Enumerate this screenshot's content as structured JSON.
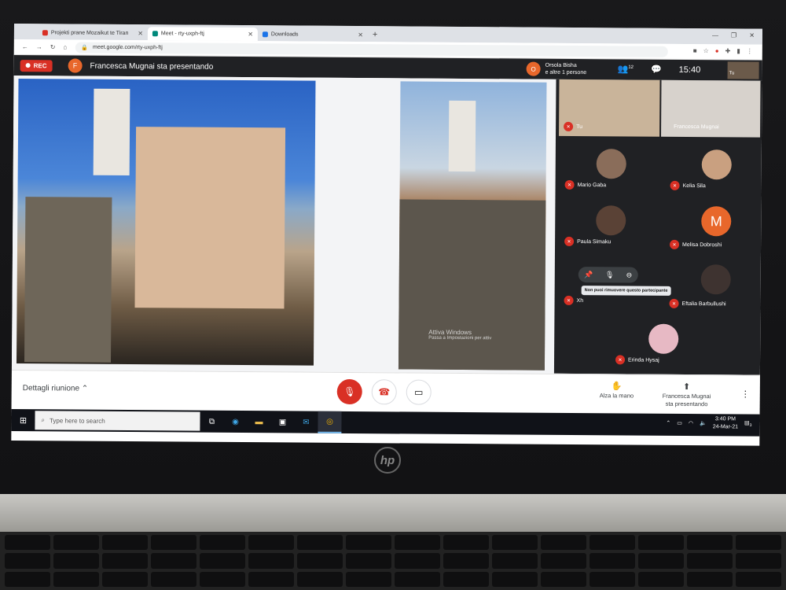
{
  "browser": {
    "tabs": [
      {
        "label": "Projekti prane Mozaikut te Tiran",
        "active": false
      },
      {
        "label": "Meet - rty-uxph-ftj",
        "active": true
      },
      {
        "label": "Downloads",
        "active": false
      }
    ],
    "url": "meet.google.com/rty-uxph-ftj"
  },
  "meet": {
    "rec_label": "REC",
    "presenter_initial": "F",
    "presenter_text": "Francesca Mugnai sta presentando",
    "others_initial": "O",
    "others_line1": "Orsola Bisha",
    "others_line2": "e altre 1 persone",
    "participants_count": "12",
    "clock": "15:40",
    "self_label": "Tu"
  },
  "participants": [
    {
      "name": "Tu"
    },
    {
      "name": "Francesca Mugnai"
    },
    {
      "name": "Mario Gaba"
    },
    {
      "name": "Kelia Sila"
    },
    {
      "name": "Paula Simaku"
    },
    {
      "name": "Melisa Dobroshi",
      "initial": "M"
    },
    {
      "name": "Xh"
    },
    {
      "name": "Eftalia Barbullushi"
    },
    {
      "name": "Erinda Hysaj"
    }
  ],
  "tooltip": "Non puoi rimuovere questo partecipante",
  "watermark": {
    "line1": "Attiva Windows",
    "line2": "Passa a Impostazioni per attiv"
  },
  "bottom": {
    "details": "Dettagli riunione",
    "raise_hand": "Alza la mano",
    "presenting_line1": "Francesca Mugnai",
    "presenting_line2": "sta presentando"
  },
  "taskbar": {
    "search_placeholder": "Type here to search",
    "time": "3:40 PM",
    "date": "24-Mar-21",
    "notifications": "3"
  },
  "brand": {
    "logo_text": "hp"
  },
  "colors": {
    "meet_red": "#d93025",
    "avatar_orange": "#e8672b",
    "meet_dark": "#202124"
  }
}
